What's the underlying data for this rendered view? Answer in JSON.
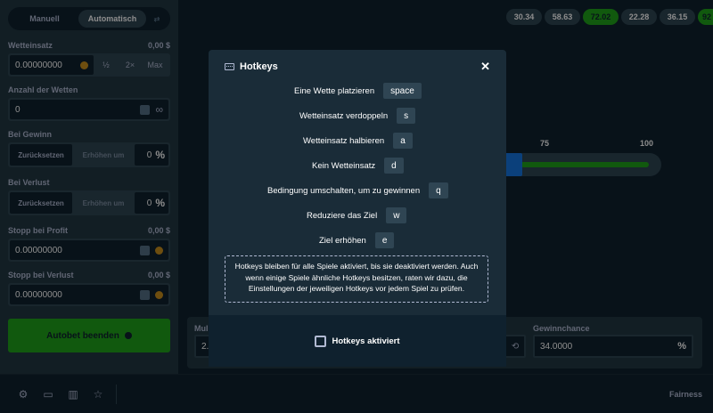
{
  "sidebar": {
    "tabs": [
      "Manuell",
      "Automatisch",
      "⇄"
    ],
    "bet_amount": {
      "label": "Wetteinsatz",
      "right": "0,00 $",
      "value": "0.00000000",
      "half": "½",
      "double": "2×",
      "max": "Max"
    },
    "num_bets": {
      "label": "Anzahl der Wetten",
      "value": "0",
      "infinity": "∞"
    },
    "on_win": {
      "label": "Bei Gewinn",
      "reset": "Zurücksetzen",
      "increase": "Erhöhen um",
      "value": "0",
      "pct": "%"
    },
    "on_loss": {
      "label": "Bei Verlust",
      "reset": "Zurücksetzen",
      "increase": "Erhöhen um",
      "value": "0",
      "pct": "%"
    },
    "stop_profit": {
      "label": "Stopp bei Profit",
      "right": "0,00 $",
      "value": "0.00000000"
    },
    "stop_loss": {
      "label": "Stopp bei Verlust",
      "right": "0,00 $",
      "value": "0.00000000"
    },
    "autobet_button": "Autobet beenden"
  },
  "history": [
    {
      "value": "30.34",
      "win": false
    },
    {
      "value": "58.63",
      "win": false
    },
    {
      "value": "72.02",
      "win": true
    },
    {
      "value": "22.28",
      "win": false
    },
    {
      "value": "36.15",
      "win": false
    },
    {
      "value": "92",
      "win": true
    }
  ],
  "game": {
    "tick_75": "75",
    "tick_100": "100",
    "multiplier_label": "Mul",
    "multiplier_value": "2.",
    "chance_label": "Gewinnchance",
    "chance_value": "34.0000",
    "chance_pct": "%",
    "refresh_icon": "⟲"
  },
  "modal": {
    "title": "Hotkeys",
    "hotkeys": [
      {
        "label": "Eine Wette platzieren",
        "key": "space"
      },
      {
        "label": "Wetteinsatz verdoppeln",
        "key": "s"
      },
      {
        "label": "Wetteinsatz halbieren",
        "key": "a"
      },
      {
        "label": "Kein Wetteinsatz",
        "key": "d"
      },
      {
        "label": "Bedingung umschalten, um zu gewinnen",
        "key": "q"
      },
      {
        "label": "Reduziere das Ziel",
        "key": "w"
      },
      {
        "label": "Ziel erhöhen",
        "key": "e"
      }
    ],
    "note": "Hotkeys bleiben für alle Spiele aktiviert, bis sie deaktiviert werden. Auch wenn einige Spiele ähnliche Hotkeys besitzen, raten wir dazu, die Einstellungen der jeweiligen Hotkeys vor jedem Spiel zu prüfen.",
    "checkbox_label": "Hotkeys aktiviert"
  },
  "footer": {
    "fairness": "Fairness"
  },
  "colors": {
    "accent_green": "#1fa31a",
    "bg": "#0f212e",
    "panel": "#213743",
    "blue": "#1475e1"
  }
}
